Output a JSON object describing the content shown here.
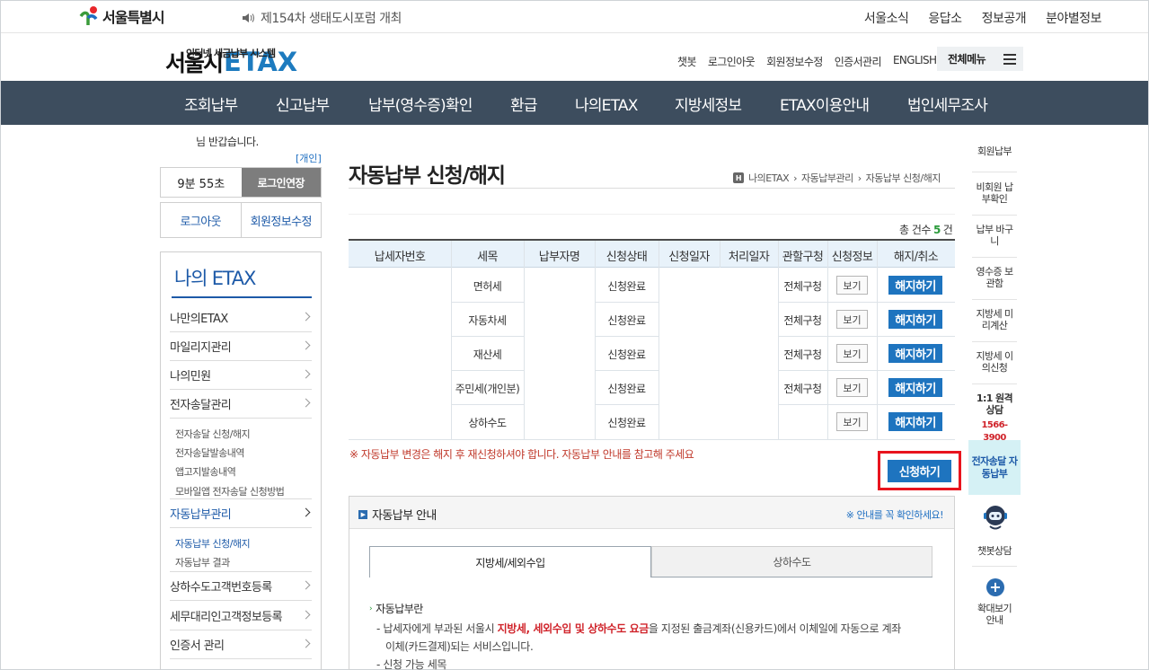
{
  "top": {
    "city_logo": "서울특별시",
    "notice": "제154차 생태도시포럼 개최",
    "links": [
      "서울소식",
      "응답소",
      "정보공개",
      "분야별정보"
    ]
  },
  "header": {
    "logo_kr": "서울시",
    "logo_en": "ETAX",
    "logo_sub": "인터넷 세금납부 시스템",
    "util_links": [
      "챗봇",
      "로그인아웃",
      "회원정보수정",
      "인증서관리",
      "ENGLISH"
    ],
    "all_menu": "전체메뉴"
  },
  "gnb": [
    "조회납부",
    "신고납부",
    "납부(영수증)확인",
    "환급",
    "나의ETAX",
    "지방세정보",
    "ETAX이용안내",
    "법인세무조사"
  ],
  "sidebar": {
    "greeting": "님 반갑습니다.",
    "member_type": "[개인]",
    "timer": "9분 55초",
    "extend": "로그인연장",
    "logout": "로그아웃",
    "edit_member": "회원정보수정",
    "lnb_title": "나의 ETAX",
    "menus": [
      "나만의ETAX",
      "마일리지관리",
      "나의민원",
      "전자송달관리",
      "자동납부관리",
      "상하수도고객번호등록",
      "세무대리인고객정보등록",
      "인증서 관리"
    ],
    "e_delivery_sub": [
      "전자송달 신청/해지",
      "전자송달발송내역",
      "앱고지발송내역",
      "모바일앱 전자송달 신청방법"
    ],
    "auto_pay_sub": [
      "자동납부 신청/해지",
      "자동납부 결과"
    ]
  },
  "main": {
    "title": "자동납부 신청/해지",
    "breadcrumb_home": "H",
    "breadcrumb": [
      "나의ETAX",
      "자동납부관리",
      "자동납부 신청/해지"
    ],
    "total_prefix": "총 건수",
    "total_count": "5",
    "total_suffix": "건",
    "table_headers": [
      "납세자번호",
      "세목",
      "납부자명",
      "신청상태",
      "신청일자",
      "처리일자",
      "관할구청",
      "신청정보",
      "해지/취소"
    ],
    "rows": [
      {
        "tax": "면허세",
        "status": "신청완료",
        "office": "전체구청",
        "view": "보기",
        "cancel": "해지하기"
      },
      {
        "tax": "자동차세",
        "status": "신청완료",
        "office": "전체구청",
        "view": "보기",
        "cancel": "해지하기"
      },
      {
        "tax": "재산세",
        "status": "신청완료",
        "office": "전체구청",
        "view": "보기",
        "cancel": "해지하기"
      },
      {
        "tax": "주민세(개인분)",
        "status": "신청완료",
        "office": "전체구청",
        "view": "보기",
        "cancel": "해지하기"
      },
      {
        "tax": "상하수도",
        "status": "신청완료",
        "office": "",
        "view": "보기",
        "cancel": "해지하기"
      }
    ],
    "warning": "※ 자동납부 변경은 해지 후 재신청하셔야 합니다. 자동납부 안내를 참고해 주세요",
    "apply": "신청하기",
    "guide": {
      "title": "자동납부 안내",
      "note": "※ 안내를 꼭 확인하세요!",
      "tabs": [
        "지방세/세외수입",
        "상하수도"
      ],
      "heading": "자동납부란",
      "line1_a": "- 납세자에게 부과된 서울시 ",
      "line1_red": "지방세, 세외수입 및 상하수도 요금",
      "line1_b": "을 지정된 출금계좌(신용카드)에서 이체일에 자동으로 계좌",
      "line2": "이체(카드결제)되는 서비스입니다.",
      "line3": "- 신청 가능 세목"
    }
  },
  "quick": {
    "items": [
      "회원납부",
      "비회원 납부확인",
      "납부 바구니",
      "영수증 보관함",
      "지방세 미리계산",
      "지방세 이의신청",
      "1:1 원격 상담"
    ],
    "phone": "1566-3900",
    "auto": "전자송달 자동납부",
    "chatbot": "챗봇상담",
    "zoom": "확대보기 안내"
  },
  "colors": {
    "gnb": "#3d4d5e",
    "accent": "#1e74bf",
    "warning": "#c0392b",
    "highlight": "#e8141e"
  }
}
